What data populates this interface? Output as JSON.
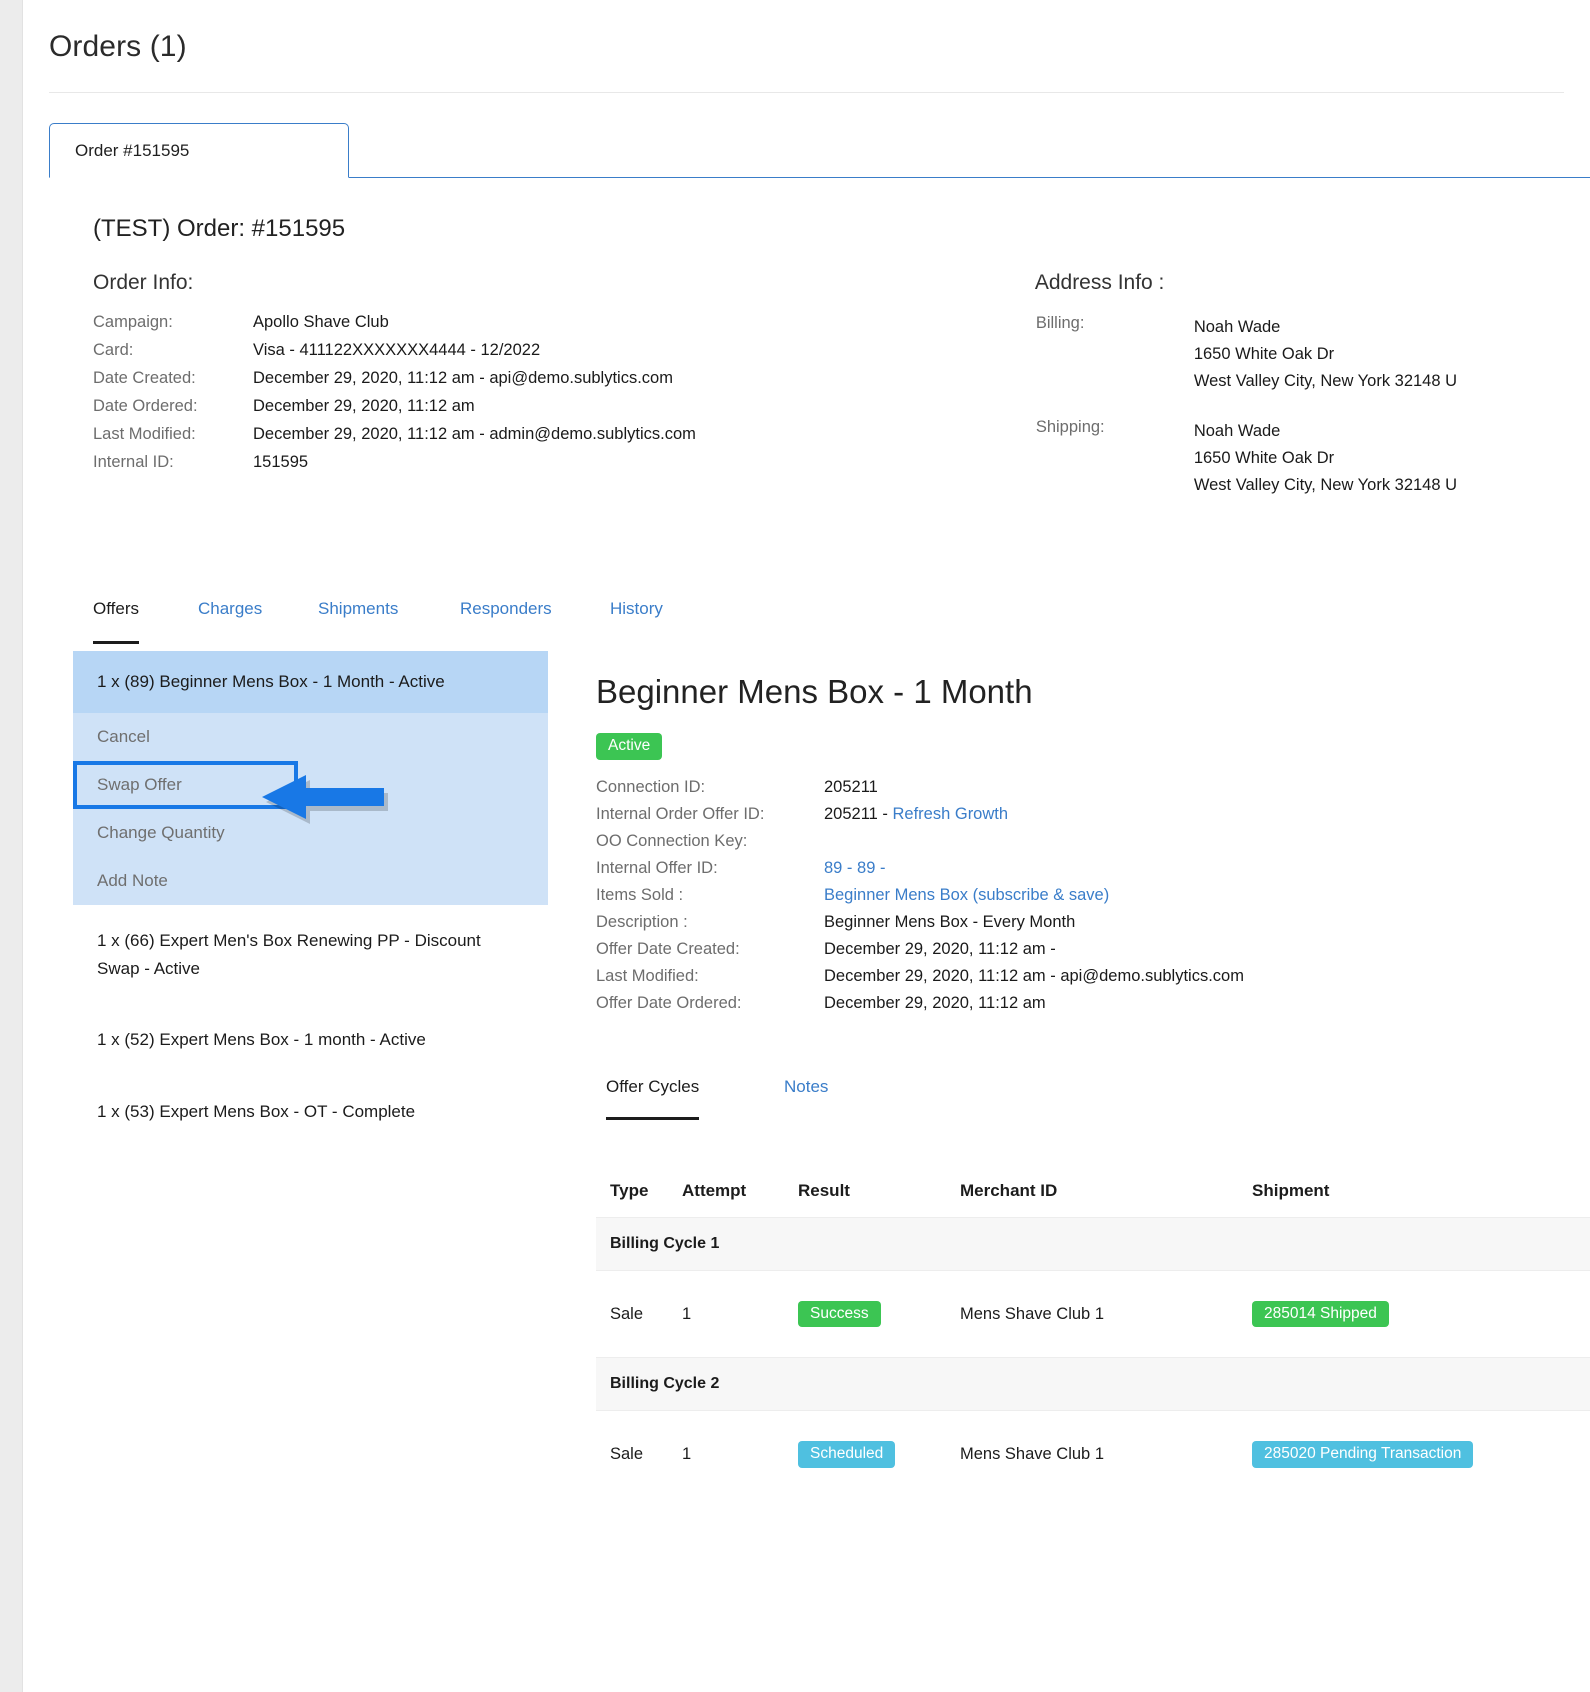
{
  "header": {
    "title": "Orders (1)"
  },
  "order_tab": {
    "label": "Order #151595"
  },
  "order_heading": "(TEST) Order: #151595",
  "order_info": {
    "heading": "Order Info:",
    "rows": [
      {
        "key": "Campaign:",
        "value": "Apollo Shave Club"
      },
      {
        "key": "Card:",
        "value": "Visa - 411122XXXXXXX4444 - 12/2022"
      },
      {
        "key": "Date Created:",
        "value": "December 29, 2020, 11:12 am - api@demo.sublytics.com"
      },
      {
        "key": "Date Ordered:",
        "value": "December 29, 2020, 11:12 am"
      },
      {
        "key": "Last Modified:",
        "value": "December 29, 2020, 11:12 am - admin@demo.sublytics.com"
      },
      {
        "key": "Internal ID:",
        "value": "151595"
      }
    ]
  },
  "address_info": {
    "heading": "Address Info :",
    "billing_key": "Billing:",
    "billing_lines": [
      "Noah Wade",
      "1650 White Oak Dr",
      "West Valley City, New York 32148 U"
    ],
    "shipping_key": "Shipping:",
    "shipping_lines": [
      "Noah Wade",
      "1650 White Oak Dr",
      "West Valley City, New York 32148 U"
    ]
  },
  "section_tabs": [
    {
      "label": "Offers",
      "active": true
    },
    {
      "label": "Charges",
      "active": false
    },
    {
      "label": "Shipments",
      "active": false
    },
    {
      "label": "Responders",
      "active": false
    },
    {
      "label": "History",
      "active": false
    }
  ],
  "offers_list": {
    "selected_label": "1 x (89) Beginner Mens Box - 1 Month - Active",
    "actions": [
      {
        "label": "Cancel",
        "highlighted": false
      },
      {
        "label": "Swap Offer",
        "highlighted": true
      },
      {
        "label": "Change Quantity",
        "highlighted": false
      },
      {
        "label": "Add Note",
        "highlighted": false
      }
    ],
    "others": [
      "1 x (66) Expert Men's Box Renewing PP - Discount Swap - Active",
      "1 x (52) Expert Mens Box - 1 month - Active",
      "1 x (53) Expert Mens Box - OT - Complete"
    ]
  },
  "detail": {
    "title": "Beginner Mens Box - 1 Month",
    "status": "Active",
    "rows": [
      {
        "key": "Connection ID:",
        "value": "205211",
        "link": ""
      },
      {
        "key": "Internal Order Offer ID:",
        "value": "205211 - ",
        "link": "Refresh Growth"
      },
      {
        "key": "OO Connection Key:",
        "value": "",
        "link": ""
      },
      {
        "key": "Internal Offer ID:",
        "value": "",
        "link": "89 - 89 -"
      },
      {
        "key": "Items Sold :",
        "value": "",
        "link": "Beginner Mens Box (subscribe & save)"
      },
      {
        "key": "Description :",
        "value": "Beginner Mens Box - Every Month",
        "link": ""
      },
      {
        "key": "Offer Date Created:",
        "value": "December 29, 2020, 11:12 am -",
        "link": ""
      },
      {
        "key": "Last Modified:",
        "value": "December 29, 2020, 11:12 am - api@demo.sublytics.com",
        "link": ""
      },
      {
        "key": "Offer Date Ordered:",
        "value": "December 29, 2020, 11:12 am",
        "link": ""
      }
    ]
  },
  "inner_tabs": [
    {
      "label": "Offer Cycles",
      "active": true
    },
    {
      "label": "Notes",
      "active": false
    }
  ],
  "cycles_table": {
    "columns": [
      "Type",
      "Attempt",
      "Result",
      "Merchant ID",
      "Shipment"
    ],
    "groups": [
      {
        "label": "Billing Cycle 1",
        "rows": [
          {
            "type": "Sale",
            "attempt": "1",
            "result": "Success",
            "result_color": "green",
            "merchant_id": "Mens Shave Club 1",
            "shipment": "285014 Shipped",
            "shipment_color": "green"
          }
        ]
      },
      {
        "label": "Billing Cycle 2",
        "rows": [
          {
            "type": "Sale",
            "attempt": "1",
            "result": "Scheduled",
            "result_color": "blue",
            "merchant_id": "Mens Shave Club 1",
            "shipment": "285020 Pending Transaction",
            "shipment_color": "blue"
          }
        ]
      }
    ]
  },
  "colors": {
    "accent_blue": "#3a7dc9",
    "badge_green": "#3cc553",
    "badge_blue": "#4fc0e0",
    "annotation_blue": "#1878e6",
    "selection_blue": "#b7d6f5",
    "panel_blue": "#cfe2f7"
  }
}
